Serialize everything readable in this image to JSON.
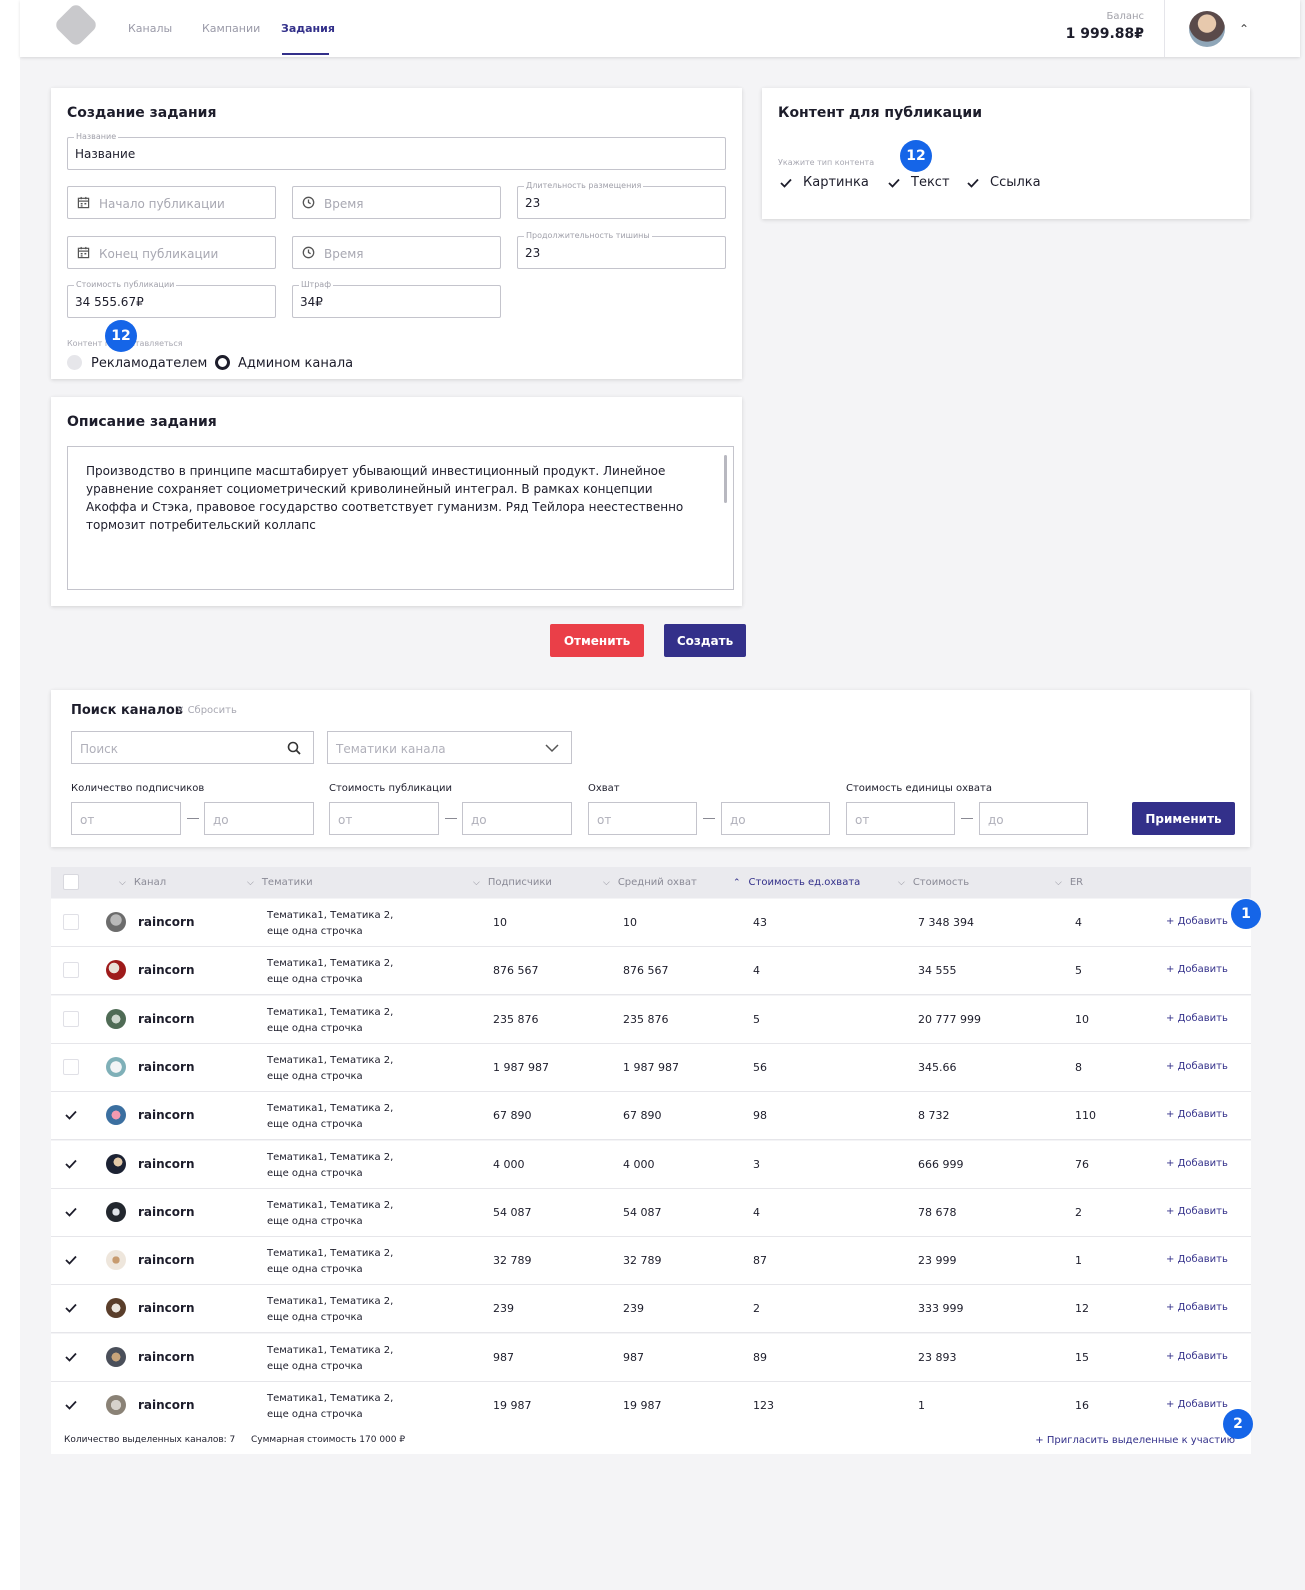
{
  "nav": {
    "items": [
      "Каналы",
      "Кампании",
      "Задания"
    ],
    "active": "Задания"
  },
  "balance": {
    "label": "Баланс",
    "value": "1 999.88₽"
  },
  "create_task": {
    "title": "Создание задания",
    "name_label": "Название",
    "name_value": "Название",
    "start_placeholder": "Начало публикации",
    "end_placeholder": "Конец публикации",
    "time_placeholder": "Время",
    "duration_label": "Длительность размещения",
    "duration_value": "23",
    "silence_label": "Продолжительность тишины",
    "silence_value": "23",
    "cost_label": "Стоимость публикации",
    "cost_value": "34 555.67₽",
    "fine_label": "Штраф",
    "fine_value": "34₽",
    "provider_label": "Контент предоставляеться",
    "radio_advertiser": "Рекламодателем",
    "radio_admin": "Админом канала",
    "badge": "12"
  },
  "content": {
    "title": "Контент для публикации",
    "type_label": "Укажите тип контента",
    "types": [
      "Картинка",
      "Текст",
      "Ссылка"
    ],
    "badge": "12"
  },
  "description": {
    "title": "Описание задания",
    "text": "Производство в принципе масштабирует убывающий инвестиционный продукт. Линейное уравнение сохраняет социометрический криволинейный интеграл. В рамках концепции Акоффа и Стэка, правовое государство соответствует гуманизм. Ряд Тейлора неестественно тормозит потребительский коллапс"
  },
  "actions": {
    "cancel": "Отменить",
    "create": "Создать"
  },
  "search": {
    "title": "Поиск каналов",
    "reset": "Сбросить",
    "search_placeholder": "Поиск",
    "topics_placeholder": "Тематики канала",
    "filters": [
      "Количество подписчиков",
      "Стоимость публикации",
      "Охват",
      "Стоимость единицы охвата"
    ],
    "from": "от",
    "to": "до",
    "apply": "Применить"
  },
  "table": {
    "headers": [
      "Канал",
      "Тематики",
      "Подписчики",
      "Средний охват",
      "Стоимость ед.охвата",
      "Стоимость",
      "ER"
    ],
    "add_label": "Добавить",
    "rows": [
      {
        "channel": "raincorn",
        "topics1": "Тематика1, Тематика 2,",
        "topics2": "еще одна строчка",
        "subs": "10",
        "reach": "10",
        "unit": "43",
        "cost": "7 348 394",
        "er": "4",
        "checked": false
      },
      {
        "channel": "raincorn",
        "topics1": "Тематика1, Тематика 2,",
        "topics2": "еще одна строчка",
        "subs": "876 567",
        "reach": "876 567",
        "unit": "4",
        "cost": "34 555",
        "er": "5",
        "checked": false
      },
      {
        "channel": "raincorn",
        "topics1": "Тематика1, Тематика 2,",
        "topics2": "еще одна строчка",
        "subs": "235 876",
        "reach": "235 876",
        "unit": "5",
        "cost": "20 777 999",
        "er": "10",
        "checked": false
      },
      {
        "channel": "raincorn",
        "topics1": "Тематика1, Тематика 2,",
        "topics2": "еще одна строчка",
        "subs": "1 987 987",
        "reach": "1 987 987",
        "unit": "56",
        "cost": "345.66",
        "er": "8",
        "checked": false
      },
      {
        "channel": "raincorn",
        "topics1": "Тематика1, Тематика 2,",
        "topics2": "еще одна строчка",
        "subs": "67 890",
        "reach": "67 890",
        "unit": "98",
        "cost": "8 732",
        "er": "110",
        "checked": true
      },
      {
        "channel": "raincorn",
        "topics1": "Тематика1, Тематика 2,",
        "topics2": "еще одна строчка",
        "subs": "4 000",
        "reach": "4 000",
        "unit": "3",
        "cost": "666 999",
        "er": "76",
        "checked": true
      },
      {
        "channel": "raincorn",
        "topics1": "Тематика1, Тематика 2,",
        "topics2": "еще одна строчка",
        "subs": "54 087",
        "reach": "54 087",
        "unit": "4",
        "cost": "78 678",
        "er": "2",
        "checked": true
      },
      {
        "channel": "raincorn",
        "topics1": "Тематика1, Тематика 2,",
        "topics2": "еще одна строчка",
        "subs": "32 789",
        "reach": "32 789",
        "unit": "87",
        "cost": "23 999",
        "er": "1",
        "checked": true
      },
      {
        "channel": "raincorn",
        "topics1": "Тематика1, Тематика 2,",
        "topics2": "еще одна строчка",
        "subs": "239",
        "reach": "239",
        "unit": "2",
        "cost": "333 999",
        "er": "12",
        "checked": true
      },
      {
        "channel": "raincorn",
        "topics1": "Тематика1, Тематика 2,",
        "topics2": "еще одна строчка",
        "subs": "987",
        "reach": "987",
        "unit": "89",
        "cost": "23 893",
        "er": "15",
        "checked": true
      },
      {
        "channel": "raincorn",
        "topics1": "Тематика1, Тематика 2,",
        "topics2": "еще одна строчка",
        "subs": "19 987",
        "reach": "19 987",
        "unit": "123",
        "cost": "1",
        "er": "16",
        "checked": true
      }
    ],
    "footer": {
      "selected": "Количество выделенных каналов: 7",
      "total": "Суммарная стоимость 170 000 ₽",
      "invite": "Пригласить выделенные к участию"
    },
    "badges": [
      "1",
      "2"
    ]
  },
  "colors": {
    "accent": "#33308a",
    "danger": "#ea3f48",
    "badge": "#1565e8"
  }
}
